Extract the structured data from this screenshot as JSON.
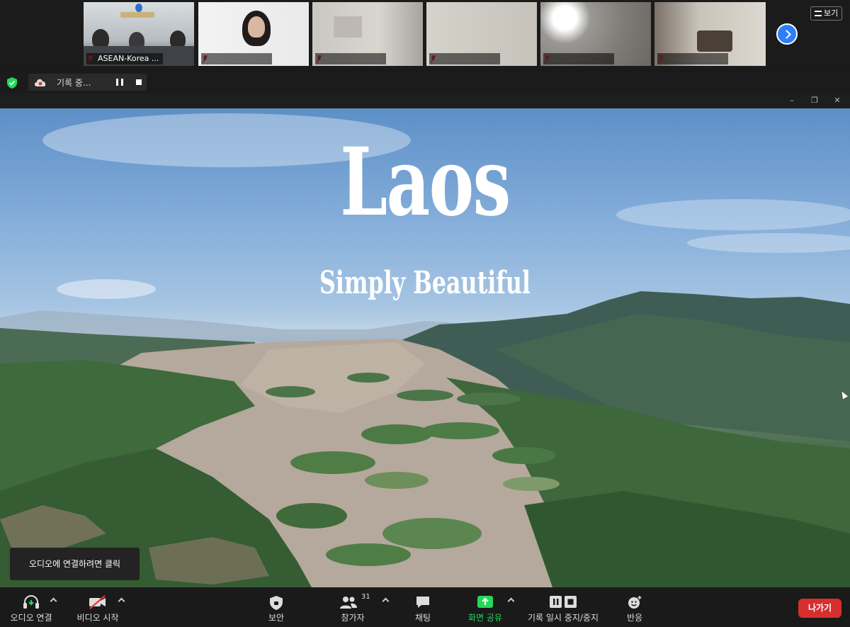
{
  "participants": [
    {
      "name": "ASEAN-Korea ..."
    },
    {
      "name": ""
    },
    {
      "name": ""
    },
    {
      "name": ""
    },
    {
      "name": ""
    },
    {
      "name": ""
    }
  ],
  "header": {
    "view_label": "보기"
  },
  "recording": {
    "status_label": "기록 중..."
  },
  "slide": {
    "title": "Laos",
    "subtitle": "Simply Beautiful"
  },
  "audio_tooltip": "오디오에 연결하려면 클릭",
  "toolbar": {
    "audio_label": "오디오 연결",
    "video_label": "비디오 시작",
    "security_label": "보안",
    "participants_label": "참가자",
    "participants_count": "31",
    "chat_label": "채팅",
    "share_label": "화면 공유",
    "record_label": "기록 일시 중지/중지",
    "reactions_label": "반응",
    "leave_label": "나가기"
  },
  "colors": {
    "share_green": "#23d959",
    "leave_red": "#d62f2f",
    "next_blue": "#2d7ff9",
    "secure_green": "#23d959"
  }
}
